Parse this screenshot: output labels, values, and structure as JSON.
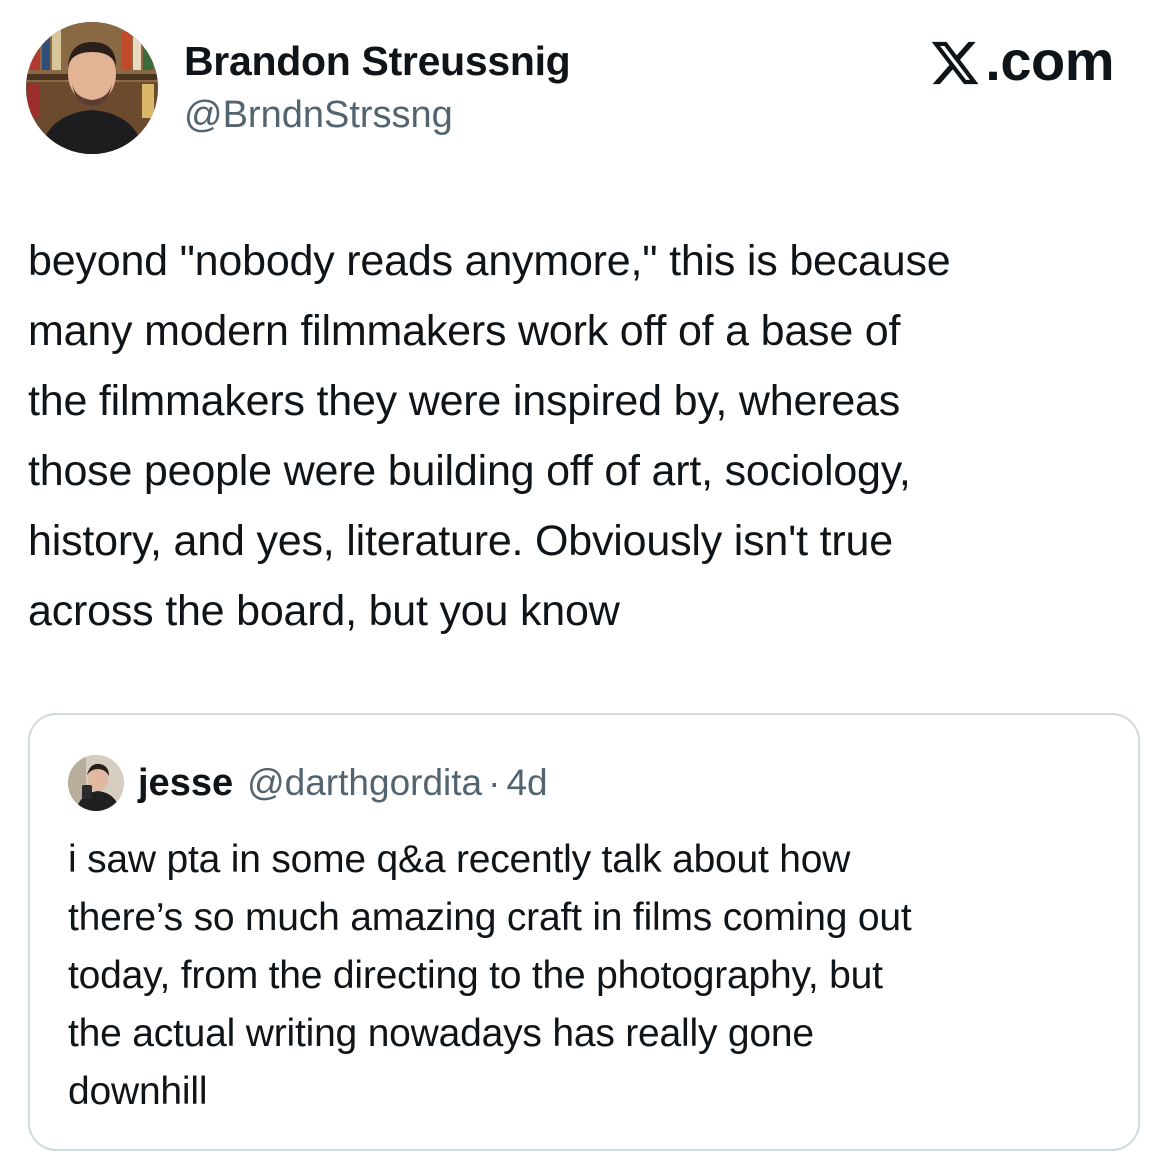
{
  "author": {
    "display_name": "Brandon Streussnig",
    "handle": "@BrndnStrssng",
    "avatar_icon": "profile-photo-avatar"
  },
  "brand": {
    "label": ".com",
    "logo_icon": "x-logo-icon"
  },
  "tweet": {
    "lines": [
      "beyond \"nobody reads anymore,\" this is because",
      "many modern filmmakers work off of a base of",
      "the filmmakers they were inspired by, whereas",
      "those people were building off of art, sociology,",
      "history, and yes, literature. Obviously isn't true",
      "across the board, but you know"
    ]
  },
  "quoted_tweet": {
    "display_name": "jesse",
    "handle": "@darthgordita",
    "separator": "·",
    "time": "4d",
    "avatar_icon": "profile-photo-avatar",
    "lines": [
      "i saw pta in some q&a recently talk about how",
      "there’s so much amazing craft in films coming out",
      "today, from the directing to the photography, but",
      "the actual writing nowadays has really gone",
      "downhill"
    ]
  },
  "colors": {
    "text_primary": "#0f1419",
    "text_secondary": "#536471",
    "border": "#cfd9de",
    "background": "#ffffff"
  }
}
